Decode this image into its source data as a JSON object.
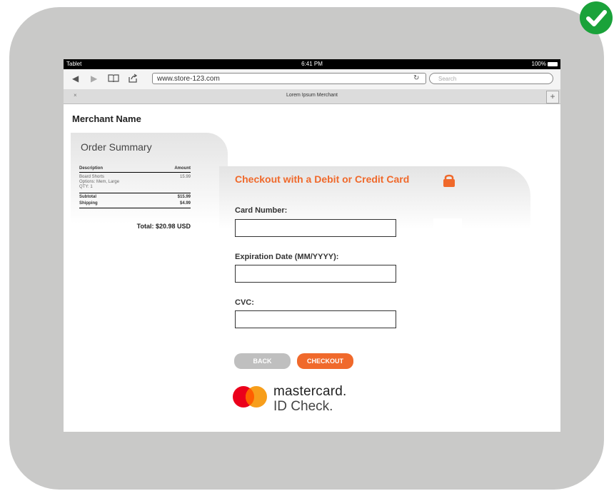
{
  "status_bar": {
    "device": "Tablet",
    "time": "6:41 PM",
    "battery": "100%"
  },
  "browser": {
    "url": "www.store-123.com",
    "search_placeholder": "Search",
    "tab_title": "Lorem Ipsum Merchant",
    "tab_close": "×",
    "new_tab": "+"
  },
  "merchant_name": "Merchant Name",
  "order_summary": {
    "title": "Order Summary",
    "col_description": "Description",
    "col_amount": "Amount",
    "items": [
      {
        "line1": "Board Shorts",
        "line2": "Options: Mem, Large",
        "line3": "QTY: 1",
        "amount": "15.99"
      }
    ],
    "subtotal_label": "Subtotal",
    "subtotal_value": "$15.99",
    "shipping_label": "Shipping",
    "shipping_value": "$4.99",
    "total": "Total: $20.98 USD"
  },
  "checkout": {
    "title": "Checkout with a Debit or Credit Card",
    "card_number_label": "Card Number:",
    "expiration_label": "Expiration Date (MM/YYYY):",
    "cvc_label": "CVC:",
    "card_number_value": "",
    "expiration_value": "",
    "cvc_value": "",
    "back_button": "BACK",
    "checkout_button": "CHECKOUT"
  },
  "brand": {
    "name": "mastercard.",
    "sub": "ID Check."
  },
  "colors": {
    "accent": "#f0692b",
    "frame": "#c9c9c8",
    "success": "#1aa23a",
    "mc_red": "#eb001b",
    "mc_yellow": "#f79e1b"
  },
  "icons": [
    "check-icon",
    "back-icon",
    "forward-icon",
    "bookmarks-icon",
    "share-icon",
    "reload-icon",
    "lock-icon",
    "mastercard-logo"
  ]
}
